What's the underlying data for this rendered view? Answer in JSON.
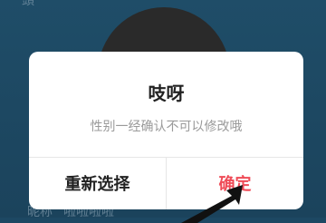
{
  "background": {
    "top_text": "頭",
    "bottom_label": "昵称",
    "bottom_value": "啦啦啦啦",
    "close_glyph": "×"
  },
  "dialog": {
    "title": "吱呀",
    "message": "性别一经确认不可以修改哦",
    "cancel_label": "重新选择",
    "confirm_label": "确定"
  },
  "colors": {
    "accent": "#ef4b57",
    "background": "#1d4863"
  }
}
